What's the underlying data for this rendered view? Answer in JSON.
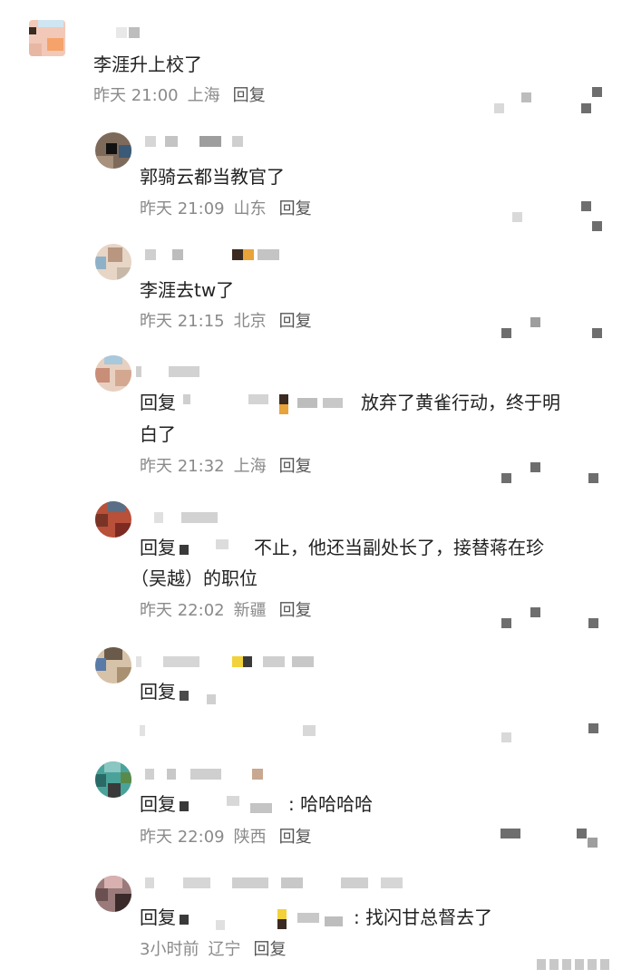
{
  "comments": [
    {
      "text": "李涯升上校了",
      "time": "昨天 21:00",
      "location": "上海",
      "reply_label": "回复"
    },
    {
      "text": "郭骑云都当教官了",
      "time": "昨天 21:09",
      "location": "山东",
      "reply_label": "回复"
    },
    {
      "text": "李涯去tw了",
      "time": "昨天 21:15",
      "location": "北京",
      "reply_label": "回复"
    },
    {
      "reply_prefix": "回复",
      "text_line1": "放弃了黄雀行动，终于明",
      "text_line2": "白了",
      "time": "昨天 21:32",
      "location": "上海",
      "reply_label": "回复"
    },
    {
      "reply_prefix": "回复",
      "text_line1": "不止，他还当副处长了，接替蒋在珍",
      "text_line2": "（吴越）的职位",
      "time": "昨天 22:02",
      "location": "新疆",
      "reply_label": "回复"
    },
    {
      "reply_prefix": "回复"
    },
    {
      "reply_prefix": "回复",
      "text": ": 哈哈哈哈",
      "time": "昨天 22:09",
      "location": "陕西",
      "reply_label": "回复"
    },
    {
      "reply_prefix": "回复",
      "text": ": 找闪甘总督去了",
      "time": "3小时前",
      "location": "辽宁",
      "reply_label": "回复"
    }
  ]
}
